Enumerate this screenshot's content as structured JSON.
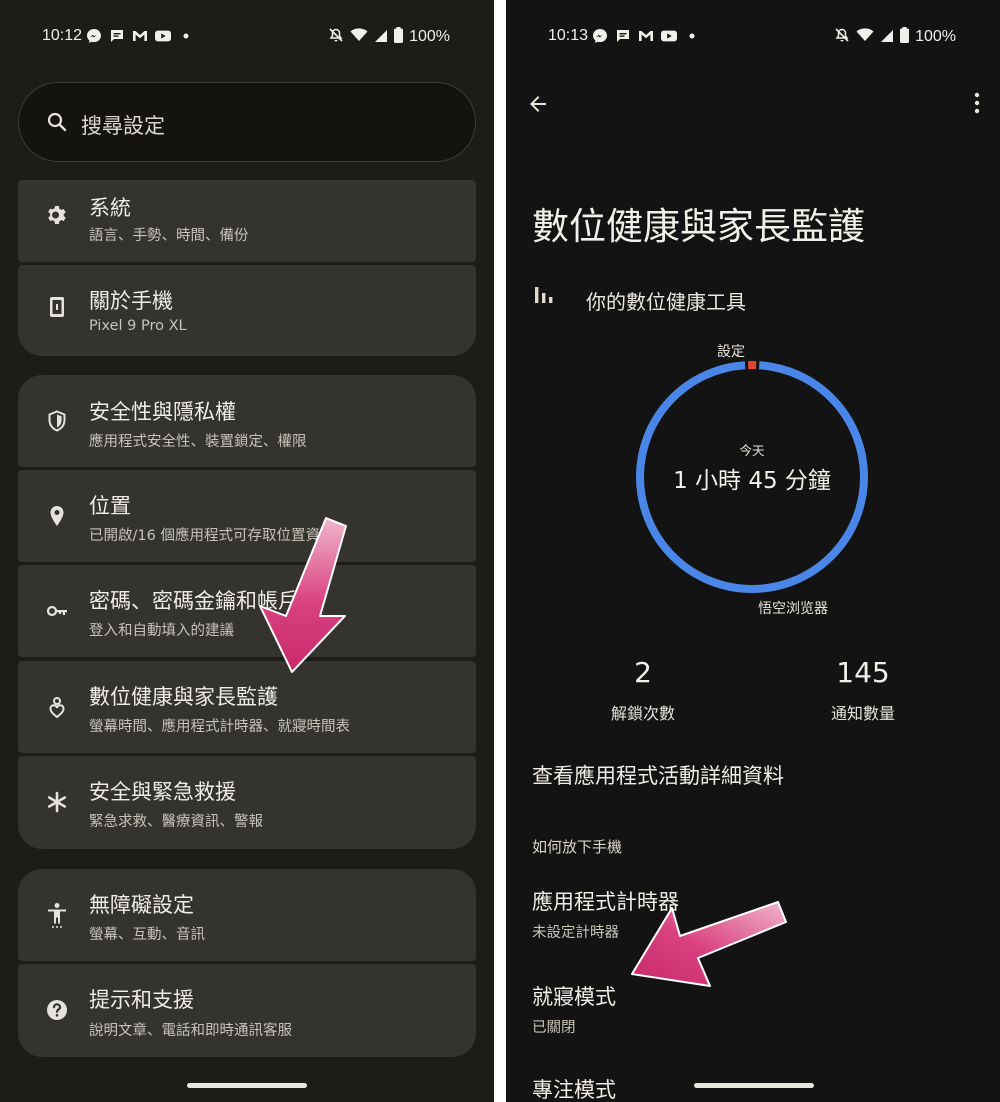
{
  "left_screen": {
    "status": {
      "time": "10:12",
      "battery": "100%"
    },
    "search": {
      "placeholder": "搜尋設定"
    },
    "items": [
      {
        "title": "系統",
        "sub": "語言、手勢、時間、備份",
        "icon": "gear-icon"
      },
      {
        "title": "關於手機",
        "sub": "Pixel 9 Pro XL",
        "icon": "phone-icon"
      },
      {
        "title": "安全性與隱私權",
        "sub": "應用程式安全性、裝置鎖定、權限",
        "icon": "shield-icon"
      },
      {
        "title": "位置",
        "sub": "已開啟/16 個應用程式可存取位置資訊",
        "icon": "location-icon"
      },
      {
        "title": "密碼、密碼金鑰和帳戶",
        "sub": "登入和自動填入的建議",
        "icon": "key-icon"
      },
      {
        "title": "數位健康與家長監護",
        "sub": "螢幕時間、應用程式計時器、就寢時間表",
        "icon": "wellbeing-icon"
      },
      {
        "title": "安全與緊急救援",
        "sub": "緊急求救、醫療資訊、警報",
        "icon": "asterisk-icon"
      },
      {
        "title": "無障礙設定",
        "sub": "螢幕、互動、音訊",
        "icon": "accessibility-icon"
      },
      {
        "title": "提示和支援",
        "sub": "說明文章、電話和即時通訊客服",
        "icon": "help-icon"
      }
    ]
  },
  "right_screen": {
    "status": {
      "time": "10:13",
      "battery": "100%"
    },
    "title": "數位健康與家長監護",
    "tools_label": "你的數位健康工具",
    "ring": {
      "top_label": "設定",
      "bottom_label": "悟空浏览器",
      "today_label": "今天",
      "total": "1 小時 45 分鐘",
      "color_main": "#4a86e8",
      "color_accent": "#e0462f",
      "accent_share": 0.012
    },
    "stats": [
      {
        "value": "2",
        "label": "解鎖次數"
      },
      {
        "value": "145",
        "label": "通知數量"
      }
    ],
    "link": "查看應用程式活動詳細資料",
    "section_heading": "如何放下手機",
    "items": [
      {
        "title": "應用程式計時器",
        "sub": "未設定計時器"
      },
      {
        "title": "就寢模式",
        "sub": "已關閉"
      },
      {
        "title": "專注模式",
        "sub": ""
      }
    ]
  },
  "colors": {
    "annotation_arrow": "#d9417f"
  }
}
